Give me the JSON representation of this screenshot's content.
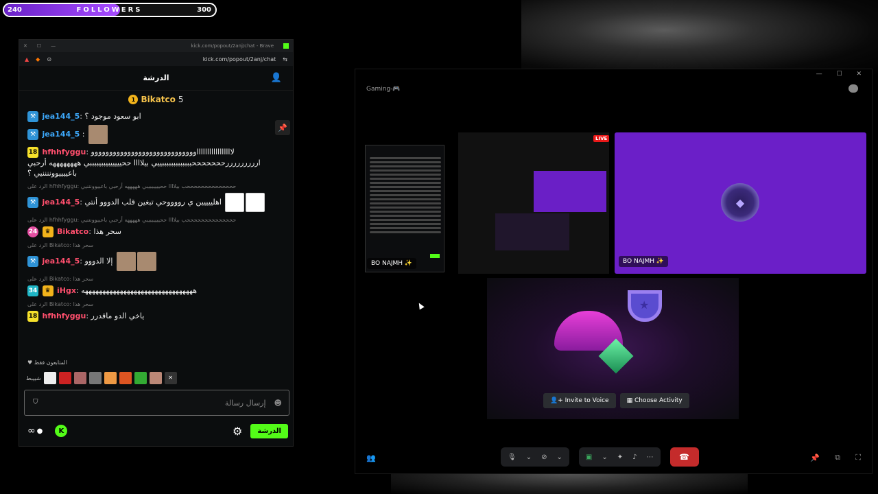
{
  "followers": {
    "min": "240",
    "label": "FOLLOWERS",
    "max": "300",
    "progress": 0.55
  },
  "browser": {
    "titlebar_url": "kick.com/popout/2anj/chat - Brave",
    "address": "kick.com/popout/2anj/chat"
  },
  "chat": {
    "header_title": "الدرشة",
    "pinned_user": "Bikatco",
    "pinned_count": "5",
    "pinned_coin": "1",
    "messages": [
      {
        "user": "jea144_5",
        "text": "ابو سعود موجود ؟"
      },
      {
        "user": "jea144_5",
        "text": ":"
      },
      {
        "badge": "18",
        "user": "hfhhfyggu",
        "text": "ووووووووووووووووووووووووووووو‎‎‎‎لااااااااااااااااا ارررررررررحححححححبببببببببببببييي بيلاااا ححيييييبيببيببببي ههههههههه أرحبي باعييييووننننيي ؟"
      },
      {
        "reply": "الرد على hfhhfyggu: ححححححححححححححب بيلاااا ححيييييبيبي هههههه أرحبي باعييوونننيي",
        "user": "jea144_5",
        "text": "اهلييييين ي رووووحي تبغين قلب الدووو أنتي"
      },
      {
        "reply": "الرد على hfhhfyggu: ححححححححححححححب بيلاااا ححيييييبيبي هههههه أرحبي باعييوونننيي",
        "badge": "24",
        "user": "Bikatco",
        "text": "سحر هذا"
      },
      {
        "reply": "الرد على Bikatco: سحر هذا",
        "user": "jea144_5",
        "text": "إلا الدووو"
      },
      {
        "reply": "الرد على Bikatco: سحر هذا",
        "badge": "34",
        "user": "iHgx",
        "text": "ههههههههههههههههههههههههههههههههه"
      },
      {
        "reply": "الرد على Bikatco: سحر هذا",
        "badge": "18",
        "user": "hfhhfyggu",
        "text": "ياخي الدو ماقدرر"
      }
    ],
    "followers_only": "المتابعون فقط",
    "emote_prefix": "شييبط",
    "input_placeholder": "إرسال رسالة",
    "send_label": "الدرشة",
    "infinity": "∞"
  },
  "discord": {
    "channel": "Gaming-🎮",
    "live": "LIVE",
    "user_small": "BO NAJMH ✨",
    "user_big": "BO NAJMH ✨",
    "invite_label": "Invite to Voice",
    "activity_label": "Choose Activity"
  }
}
